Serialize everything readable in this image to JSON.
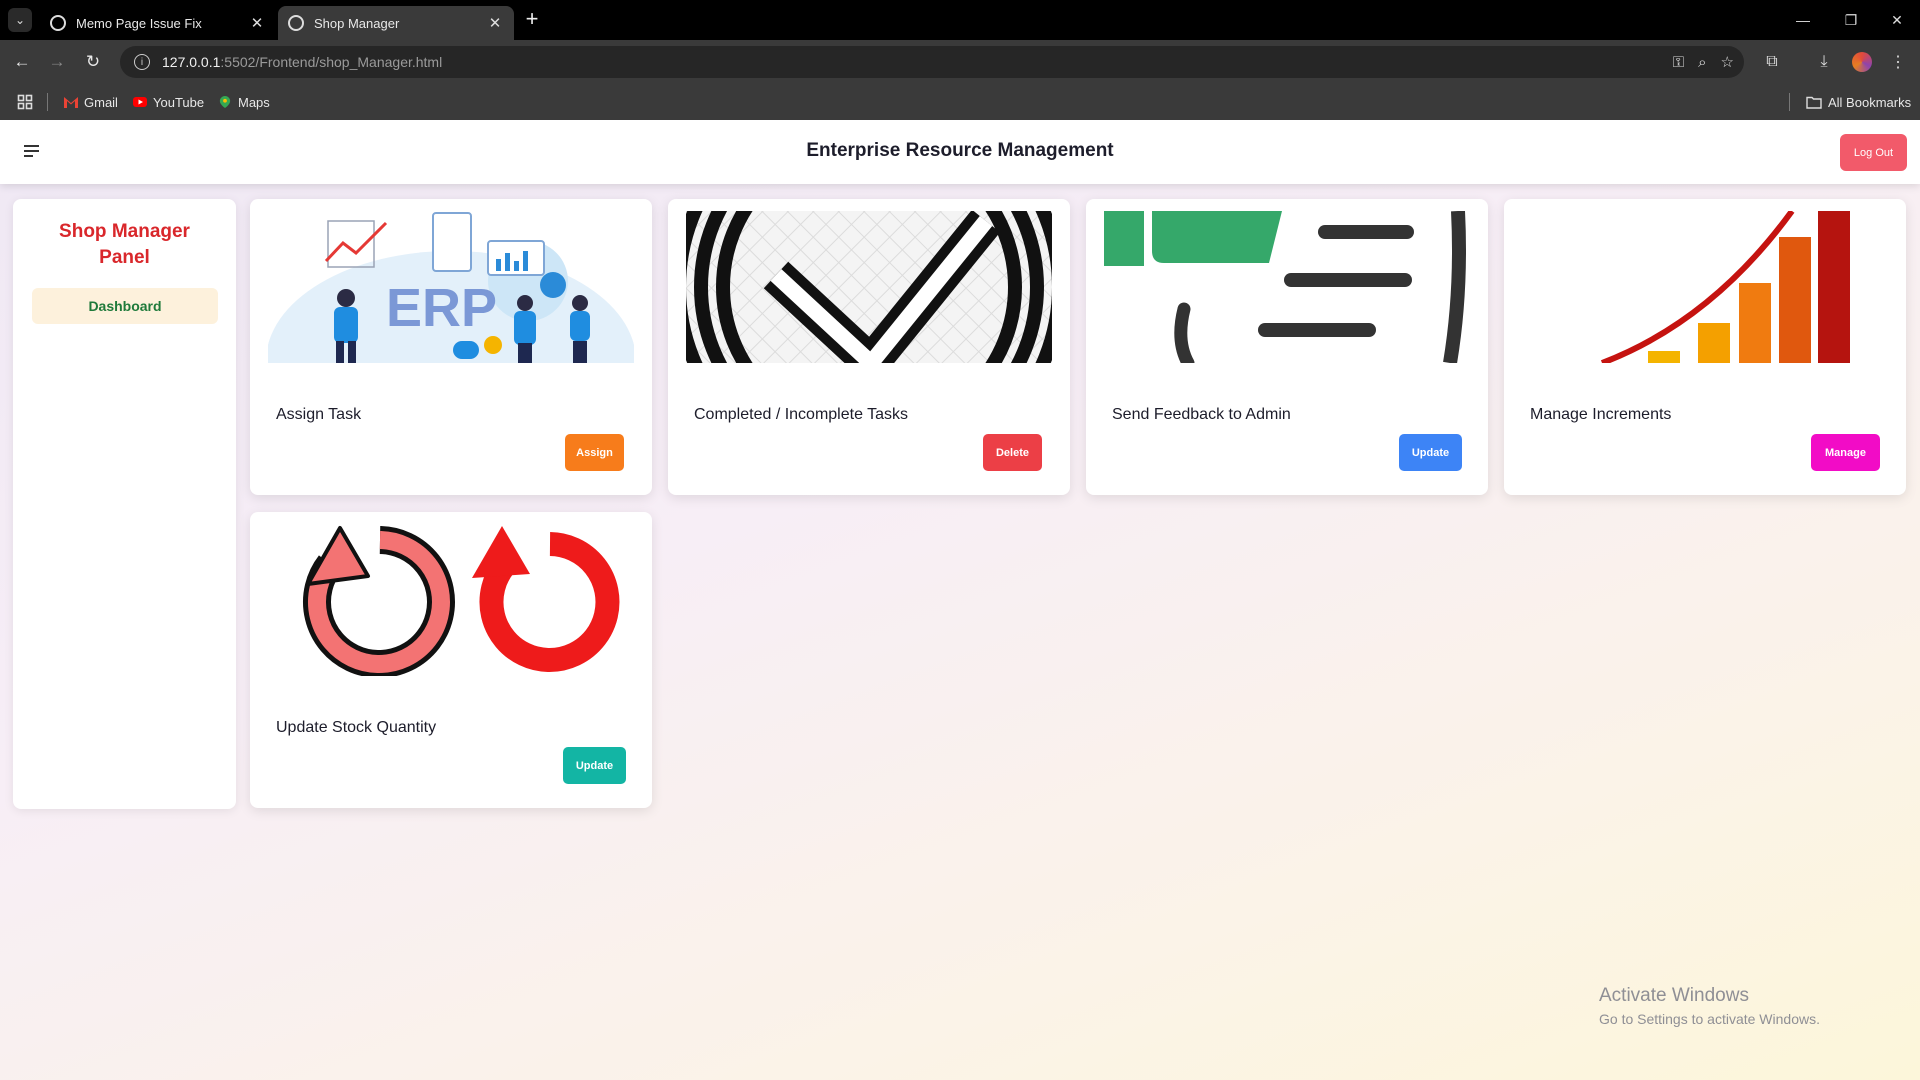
{
  "browser": {
    "tabs": [
      {
        "title": "Memo Page Issue Fix",
        "active": false
      },
      {
        "title": "Shop Manager",
        "active": true
      }
    ],
    "url_host": "127.0.0.1",
    "url_path": ":5502/Frontend/shop_Manager.html",
    "bookmarks": [
      "Gmail",
      "YouTube",
      "Maps"
    ],
    "all_bookmarks": "All Bookmarks"
  },
  "header": {
    "title": "Enterprise Resource Management",
    "logout_label": "Log Out",
    "logout_color": "#f25a6a"
  },
  "sidebar": {
    "title": "Shop Manager Panel",
    "items": [
      {
        "label": "Dashboard"
      }
    ]
  },
  "cards": [
    {
      "title": "Assign Task",
      "button": "Assign",
      "button_color": "#f77c1b",
      "image": "erp-illustration"
    },
    {
      "title": "Completed / Incomplete Tasks",
      "button": "Delete",
      "button_color": "#ec3f46",
      "image": "checkmark-circle"
    },
    {
      "title": "Send Feedback to Admin",
      "button": "Update",
      "button_color": "#3d84f6",
      "image": "feedback-bars"
    },
    {
      "title": "Manage Increments",
      "button": "Manage",
      "button_color": "#f20cc6",
      "image": "growth-chart"
    },
    {
      "title": "Update Stock Quantity",
      "button": "Update",
      "button_color": "#13b5a4",
      "image": "refresh-arrows"
    }
  ],
  "watermark": {
    "line1": "Activate Windows",
    "line2": "Go to Settings to activate Windows."
  }
}
